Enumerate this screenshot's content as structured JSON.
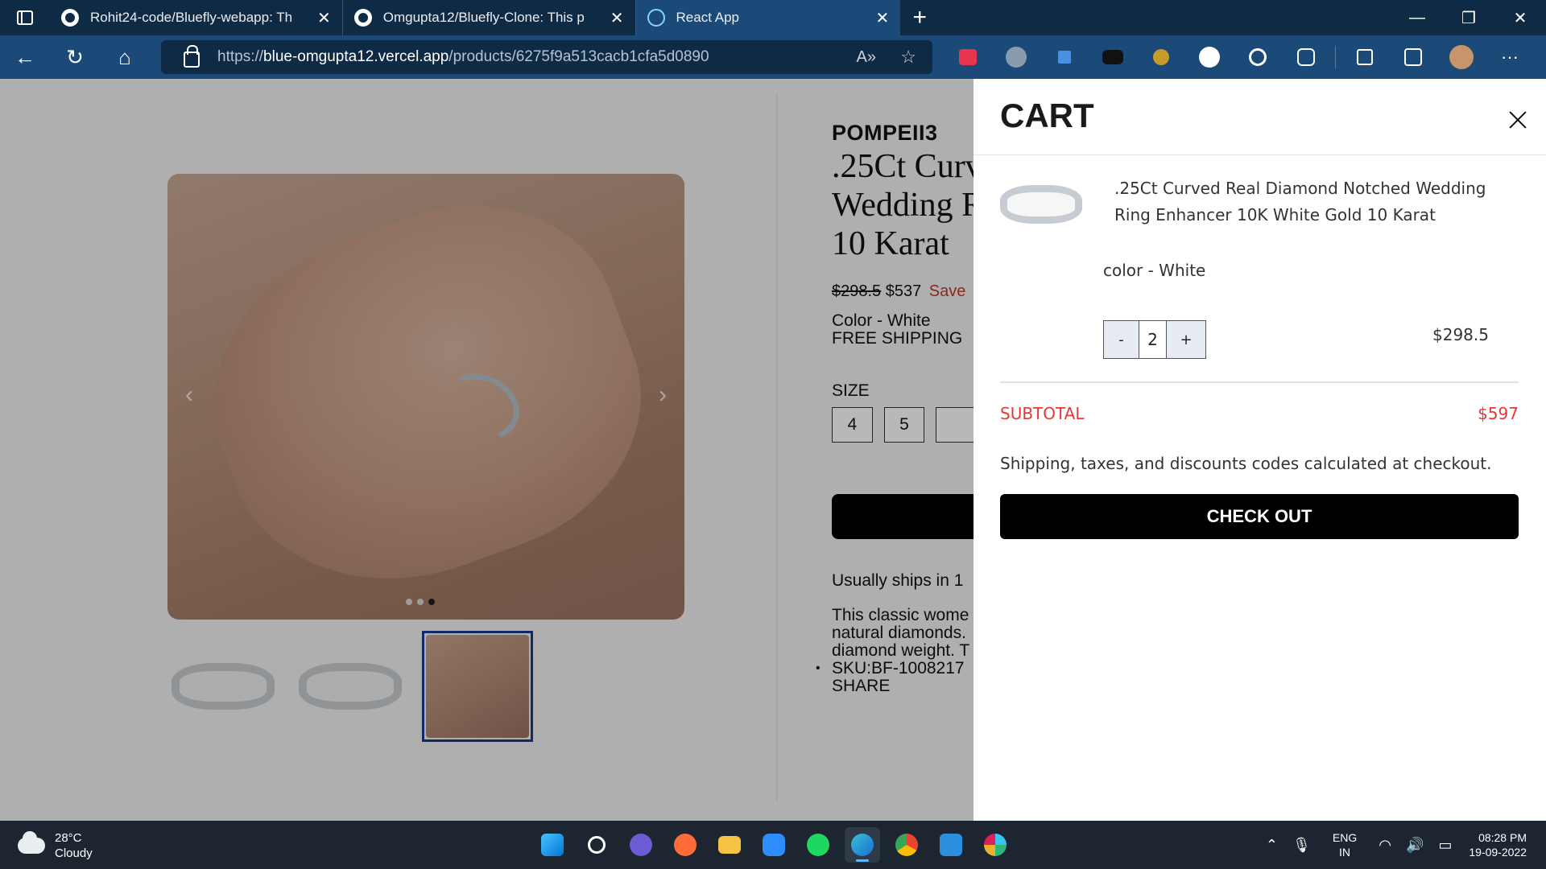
{
  "browser": {
    "tabs": [
      {
        "title": "Rohit24-code/Bluefly-webapp: Th",
        "active": false
      },
      {
        "title": "Omgupta12/Bluefly-Clone: This p",
        "active": false
      },
      {
        "title": "React App",
        "active": true
      }
    ],
    "url_prefix": "https://",
    "url_host": "blue-omgupta12.vercel.app",
    "url_path": "/products/6275f9a513cacb1cfa5d0890",
    "icons": [
      "back-icon",
      "refresh-icon",
      "home-icon",
      "lock-icon",
      "read-aloud-icon",
      "add-favorite-icon",
      "settings-more-icon"
    ]
  },
  "product": {
    "brand": "POMPEII3",
    "title_lines": [
      ".25Ct Curv",
      "Wedding R",
      "10 Karat"
    ],
    "original_price": "$298.5",
    "price": "$537",
    "save_label": "Save",
    "color": "Color - White",
    "shipping": "FREE SHIPPING",
    "size_label": "SIZE",
    "sizes": [
      "4",
      "5"
    ],
    "ships_note": "Usually ships in 1",
    "description_lines": [
      "This classic wome",
      "natural diamonds.",
      "diamond weight. T"
    ],
    "sku": "SKU:BF-1008217",
    "share": "SHARE"
  },
  "cart": {
    "title": "CART",
    "item": {
      "name": ".25Ct Curved Real Diamond Notched Wedding Ring Enhancer 10K White Gold 10 Karat",
      "color": "color - White",
      "qty_minus": "-",
      "qty": "2",
      "qty_plus": "+",
      "price": "$298.5"
    },
    "subtotal_label": "SUBTOTAL",
    "subtotal_value": "$597",
    "shipping_note": "Shipping, taxes, and discounts codes calculated at checkout.",
    "checkout_label": "CHECK OUT",
    "accent": "#e53935"
  },
  "taskbar": {
    "temperature": "28°C",
    "weather": "Cloudy",
    "lang1": "ENG",
    "lang2": "IN",
    "time": "08:28 PM",
    "date": "19-09-2022"
  }
}
